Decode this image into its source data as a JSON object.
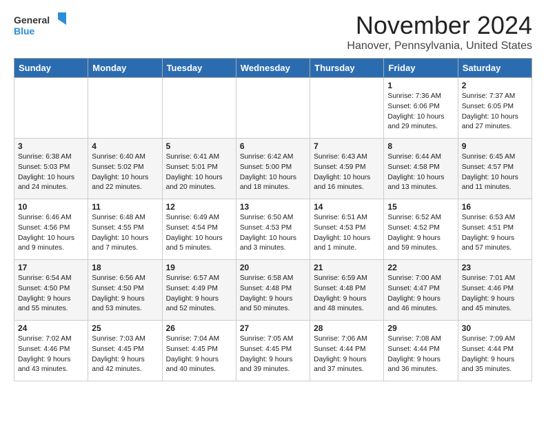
{
  "header": {
    "logo_general": "General",
    "logo_blue": "Blue",
    "month_title": "November 2024",
    "location": "Hanover, Pennsylvania, United States"
  },
  "weekdays": [
    "Sunday",
    "Monday",
    "Tuesday",
    "Wednesday",
    "Thursday",
    "Friday",
    "Saturday"
  ],
  "weeks": [
    [
      {
        "day": "",
        "info": ""
      },
      {
        "day": "",
        "info": ""
      },
      {
        "day": "",
        "info": ""
      },
      {
        "day": "",
        "info": ""
      },
      {
        "day": "",
        "info": ""
      },
      {
        "day": "1",
        "info": "Sunrise: 7:36 AM\nSunset: 6:06 PM\nDaylight: 10 hours\nand 29 minutes."
      },
      {
        "day": "2",
        "info": "Sunrise: 7:37 AM\nSunset: 6:05 PM\nDaylight: 10 hours\nand 27 minutes."
      }
    ],
    [
      {
        "day": "3",
        "info": "Sunrise: 6:38 AM\nSunset: 5:03 PM\nDaylight: 10 hours\nand 24 minutes."
      },
      {
        "day": "4",
        "info": "Sunrise: 6:40 AM\nSunset: 5:02 PM\nDaylight: 10 hours\nand 22 minutes."
      },
      {
        "day": "5",
        "info": "Sunrise: 6:41 AM\nSunset: 5:01 PM\nDaylight: 10 hours\nand 20 minutes."
      },
      {
        "day": "6",
        "info": "Sunrise: 6:42 AM\nSunset: 5:00 PM\nDaylight: 10 hours\nand 18 minutes."
      },
      {
        "day": "7",
        "info": "Sunrise: 6:43 AM\nSunset: 4:59 PM\nDaylight: 10 hours\nand 16 minutes."
      },
      {
        "day": "8",
        "info": "Sunrise: 6:44 AM\nSunset: 4:58 PM\nDaylight: 10 hours\nand 13 minutes."
      },
      {
        "day": "9",
        "info": "Sunrise: 6:45 AM\nSunset: 4:57 PM\nDaylight: 10 hours\nand 11 minutes."
      }
    ],
    [
      {
        "day": "10",
        "info": "Sunrise: 6:46 AM\nSunset: 4:56 PM\nDaylight: 10 hours\nand 9 minutes."
      },
      {
        "day": "11",
        "info": "Sunrise: 6:48 AM\nSunset: 4:55 PM\nDaylight: 10 hours\nand 7 minutes."
      },
      {
        "day": "12",
        "info": "Sunrise: 6:49 AM\nSunset: 4:54 PM\nDaylight: 10 hours\nand 5 minutes."
      },
      {
        "day": "13",
        "info": "Sunrise: 6:50 AM\nSunset: 4:53 PM\nDaylight: 10 hours\nand 3 minutes."
      },
      {
        "day": "14",
        "info": "Sunrise: 6:51 AM\nSunset: 4:53 PM\nDaylight: 10 hours\nand 1 minute."
      },
      {
        "day": "15",
        "info": "Sunrise: 6:52 AM\nSunset: 4:52 PM\nDaylight: 9 hours\nand 59 minutes."
      },
      {
        "day": "16",
        "info": "Sunrise: 6:53 AM\nSunset: 4:51 PM\nDaylight: 9 hours\nand 57 minutes."
      }
    ],
    [
      {
        "day": "17",
        "info": "Sunrise: 6:54 AM\nSunset: 4:50 PM\nDaylight: 9 hours\nand 55 minutes."
      },
      {
        "day": "18",
        "info": "Sunrise: 6:56 AM\nSunset: 4:50 PM\nDaylight: 9 hours\nand 53 minutes."
      },
      {
        "day": "19",
        "info": "Sunrise: 6:57 AM\nSunset: 4:49 PM\nDaylight: 9 hours\nand 52 minutes."
      },
      {
        "day": "20",
        "info": "Sunrise: 6:58 AM\nSunset: 4:48 PM\nDaylight: 9 hours\nand 50 minutes."
      },
      {
        "day": "21",
        "info": "Sunrise: 6:59 AM\nSunset: 4:48 PM\nDaylight: 9 hours\nand 48 minutes."
      },
      {
        "day": "22",
        "info": "Sunrise: 7:00 AM\nSunset: 4:47 PM\nDaylight: 9 hours\nand 46 minutes."
      },
      {
        "day": "23",
        "info": "Sunrise: 7:01 AM\nSunset: 4:46 PM\nDaylight: 9 hours\nand 45 minutes."
      }
    ],
    [
      {
        "day": "24",
        "info": "Sunrise: 7:02 AM\nSunset: 4:46 PM\nDaylight: 9 hours\nand 43 minutes."
      },
      {
        "day": "25",
        "info": "Sunrise: 7:03 AM\nSunset: 4:45 PM\nDaylight: 9 hours\nand 42 minutes."
      },
      {
        "day": "26",
        "info": "Sunrise: 7:04 AM\nSunset: 4:45 PM\nDaylight: 9 hours\nand 40 minutes."
      },
      {
        "day": "27",
        "info": "Sunrise: 7:05 AM\nSunset: 4:45 PM\nDaylight: 9 hours\nand 39 minutes."
      },
      {
        "day": "28",
        "info": "Sunrise: 7:06 AM\nSunset: 4:44 PM\nDaylight: 9 hours\nand 37 minutes."
      },
      {
        "day": "29",
        "info": "Sunrise: 7:08 AM\nSunset: 4:44 PM\nDaylight: 9 hours\nand 36 minutes."
      },
      {
        "day": "30",
        "info": "Sunrise: 7:09 AM\nSunset: 4:44 PM\nDaylight: 9 hours\nand 35 minutes."
      }
    ]
  ]
}
